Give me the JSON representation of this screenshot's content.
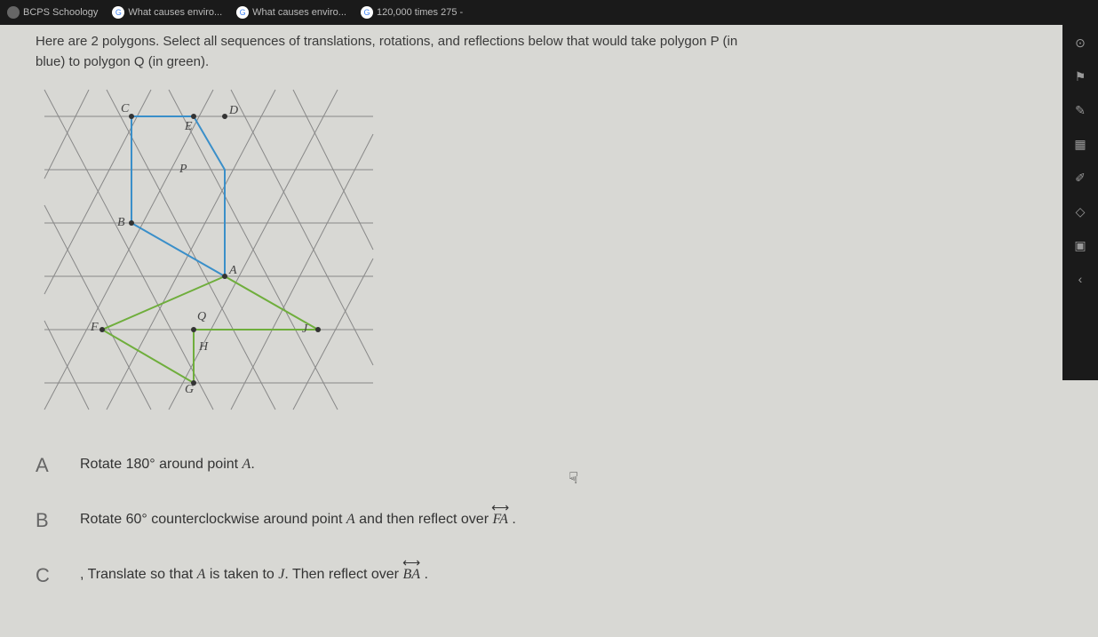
{
  "topbar": {
    "tabs": [
      {
        "label": "BCPS Schoology"
      },
      {
        "label": "What causes enviro..."
      },
      {
        "label": "What causes enviro..."
      },
      {
        "label": "120,000 times 275 -"
      }
    ]
  },
  "question": {
    "line1": "Here are 2 polygons.  Select all sequences of translations, rotations, and reflections below that would take polygon P (in",
    "line2": "blue) to polygon Q (in green)."
  },
  "diagram": {
    "labels": {
      "C": "C",
      "D": "D",
      "E": "E",
      "P": "P",
      "B": "B",
      "A": "A",
      "Q": "Q",
      "F": "F",
      "J": "J",
      "H": "H",
      "G": "G"
    }
  },
  "options": {
    "A": {
      "letter": "A",
      "text_pre": "Rotate ",
      "deg": "180°",
      "text_post": " around point ",
      "pt": "A",
      "end": "."
    },
    "B": {
      "letter": "B",
      "text_pre": "Rotate ",
      "deg": "60°",
      "text_mid": " counterclockwise around point ",
      "pt1": "A",
      "text_mid2": " and then reflect over ",
      "line": "FA",
      "end": " ."
    },
    "C": {
      "letter": "C",
      "text_pre": ", Translate so that ",
      "pt1": "A",
      "text_mid": " is taken to ",
      "pt2": "J",
      "text_mid2": ". Then reflect over ",
      "line": "BA",
      "end": " ."
    }
  },
  "sidebar": {
    "icons": [
      "extension",
      "flag",
      "edit",
      "grid",
      "pencil",
      "eraser",
      "clipboard",
      "chevron"
    ]
  }
}
